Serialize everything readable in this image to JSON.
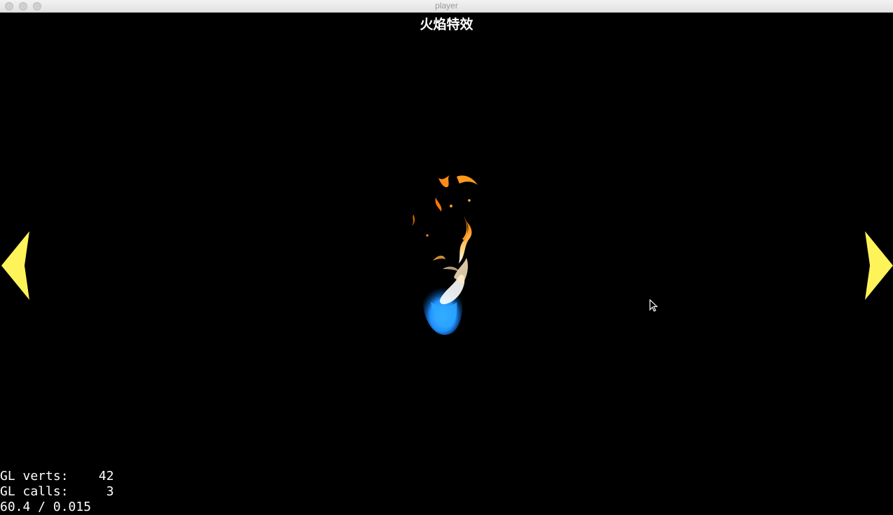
{
  "window": {
    "title": "player"
  },
  "scene": {
    "title": "火焰特效"
  },
  "nav": {
    "prev_color": "#fff35a",
    "next_color": "#fff35a"
  },
  "effect": {
    "icon": "flame-particle",
    "colors": [
      "#ff8c1a",
      "#ffffff",
      "#1f9bff"
    ]
  },
  "stats": {
    "verts_label": "GL verts:",
    "verts_value": "42",
    "calls_label": "GL calls:",
    "calls_value": "3",
    "fps_line": "60.4 / 0.015"
  }
}
